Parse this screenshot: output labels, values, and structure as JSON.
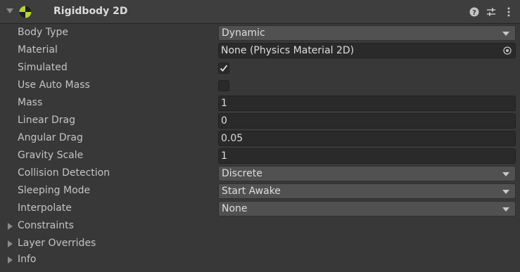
{
  "component": {
    "title": "Rigidbody 2D",
    "icon": "rigidbody2d-icon",
    "buttons": [
      "help-icon",
      "presets-icon",
      "kebab-menu-icon"
    ]
  },
  "properties": {
    "body_type": {
      "label": "Body Type",
      "value": "Dynamic"
    },
    "material": {
      "label": "Material",
      "value": "None (Physics Material 2D)"
    },
    "simulated": {
      "label": "Simulated",
      "checked": true
    },
    "use_auto_mass": {
      "label": "Use Auto Mass",
      "checked": false
    },
    "mass": {
      "label": "Mass",
      "value": "1"
    },
    "linear_drag": {
      "label": "Linear Drag",
      "value": "0"
    },
    "angular_drag": {
      "label": "Angular Drag",
      "value": "0.05"
    },
    "gravity_scale": {
      "label": "Gravity Scale",
      "value": "1"
    },
    "collision_detection": {
      "label": "Collision Detection",
      "value": "Discrete"
    },
    "sleeping_mode": {
      "label": "Sleeping Mode",
      "value": "Start Awake"
    },
    "interpolate": {
      "label": "Interpolate",
      "value": "None"
    }
  },
  "foldouts": {
    "constraints": "Constraints",
    "layer_overrides": "Layer Overrides",
    "info": "Info"
  },
  "colors": {
    "panel": "#383838",
    "header": "#3e3e3e",
    "dropdown": "#515151",
    "field": "#2a2a2a",
    "icon_green": "#b5d334"
  }
}
